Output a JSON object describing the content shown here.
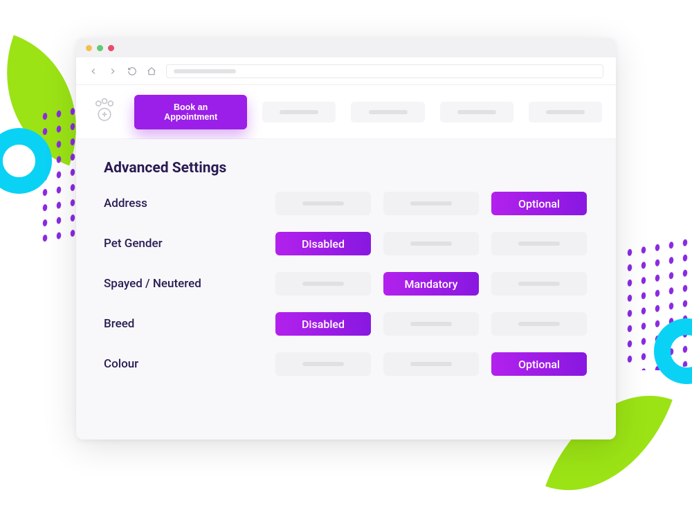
{
  "toolbar": {
    "book_label": "Book an Appointment"
  },
  "section": {
    "title": "Advanced Settings"
  },
  "options": {
    "disabled": "Disabled",
    "mandatory": "Mandatory",
    "optional": "Optional"
  },
  "rows": [
    {
      "label": "Address",
      "selected": 2
    },
    {
      "label": "Pet Gender",
      "selected": 0
    },
    {
      "label": "Spayed  / Neutered",
      "selected": 1
    },
    {
      "label": "Breed",
      "selected": 0
    },
    {
      "label": "Colour",
      "selected": 2
    }
  ]
}
